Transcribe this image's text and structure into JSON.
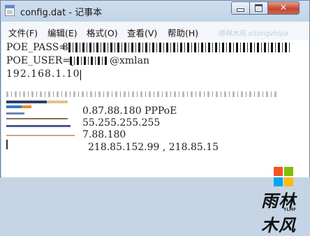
{
  "window": {
    "title": "config.dat - 记事本",
    "controls": {
      "minimize": "minimize-icon",
      "maximize": "maximize-icon",
      "close": "close-icon"
    }
  },
  "menu": {
    "file": "文件(F)",
    "edit": "编辑(E)",
    "format": "格式(O)",
    "view": "查看(V)",
    "help": "帮助(H)",
    "watermark": "雨林木风 xitongzhijia"
  },
  "lines": {
    "l1_prefix": "POE_PASS=",
    "l2_prefix": "POE_USER=p",
    "l2_suffix": "@xmlan",
    "l3": "192.168.1.10",
    "l5": "0.87.88.180 PPPoE",
    "l6": "55.255.255.255",
    "l7": "7.88.180",
    "l8": "218.85.152.99 , 218.85.15"
  },
  "brand": {
    "logo_colors": [
      "#f35325",
      "#81bc06",
      "#05a6f0",
      "#ffba08"
    ],
    "name": "雨林木风",
    "sub": "YLMF"
  }
}
